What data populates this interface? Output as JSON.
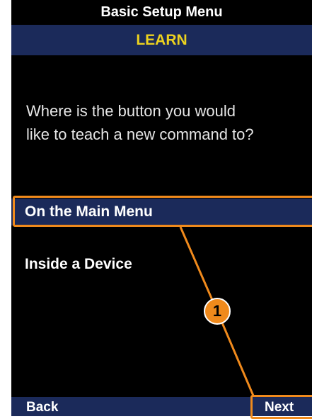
{
  "header": {
    "title": "Basic Setup Menu",
    "subtitle": "LEARN"
  },
  "prompt": {
    "text": "Where is the button you would\nlike to teach a new command to?"
  },
  "menu": {
    "items": [
      {
        "label": "On the Main Menu",
        "selected": true
      },
      {
        "label": "Inside a Device",
        "selected": false
      }
    ]
  },
  "softkeys": {
    "left": "Back",
    "right": "Next"
  },
  "callout": {
    "number": "1"
  },
  "colors": {
    "background": "#000000",
    "bar": "#1b2a5a",
    "accent_text": "#ecd21f",
    "callout": "#f08a1c"
  }
}
